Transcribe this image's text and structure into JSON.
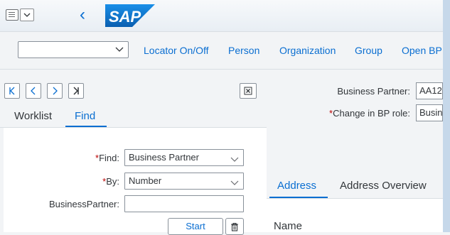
{
  "header": {
    "logo_text": "SAP",
    "back_glyph": "‹",
    "icons": {
      "menu": "menu-icon",
      "back": "chevron-left-icon"
    }
  },
  "toolbar": {
    "select_value": "",
    "links": [
      "Locator On/Off",
      "Person",
      "Organization",
      "Group",
      "Open BP"
    ]
  },
  "locator": {
    "nav_buttons": [
      "first-icon",
      "previous-icon",
      "next-icon",
      "last-icon"
    ],
    "tabs": [
      {
        "label": "Worklist",
        "active": false
      },
      {
        "label": "Find",
        "active": true
      }
    ],
    "form": {
      "find_label": "Find:",
      "find_value": "Business Partner",
      "by_label": "By:",
      "by_value": "Number",
      "bp_label": "BusinessPartner:",
      "bp_value": ""
    },
    "start_label": "Start"
  },
  "detail": {
    "bp_label": "Business Partner:",
    "bp_value": "AA12",
    "role_label": "Change in BP role:",
    "role_value": "Busin",
    "tabs": [
      {
        "label": "Address",
        "active": true
      },
      {
        "label": "Address Overview",
        "active": false
      }
    ],
    "section_title": "Name"
  },
  "colors": {
    "accent": "#0a6ed1",
    "required": "#bb0000",
    "logo_blue": "#0f7cd6"
  }
}
